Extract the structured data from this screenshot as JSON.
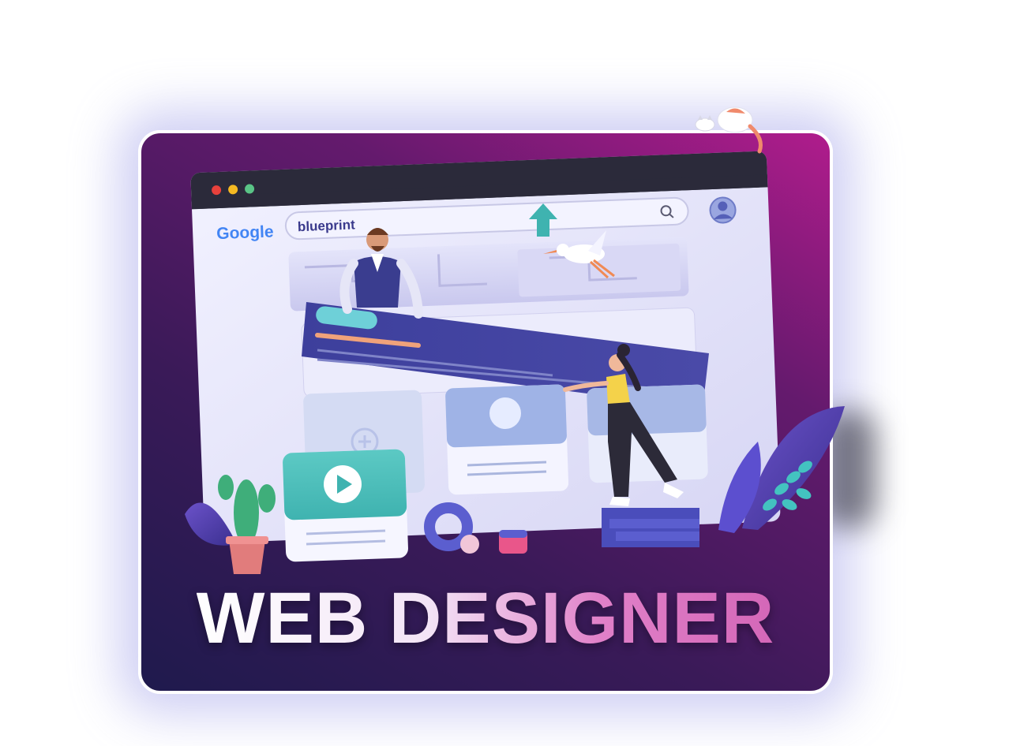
{
  "browser": {
    "logo_text": "Google",
    "search_value": "blueprint"
  },
  "headline": "WEB DESIGNER",
  "colors": {
    "card_gradient_start": "#1f1a4d",
    "card_gradient_end": "#b01c8c",
    "browser_bar": "#2b2a3a",
    "browser_body": "#e9e9fb",
    "banner": "#3e3f9a",
    "accent_teal": "#4fc3c0",
    "headline_gradient_end": "#d467b8"
  },
  "icons": [
    "search-icon",
    "user-avatar-icon",
    "upload-arrow-icon",
    "play-icon",
    "plus-icon"
  ]
}
